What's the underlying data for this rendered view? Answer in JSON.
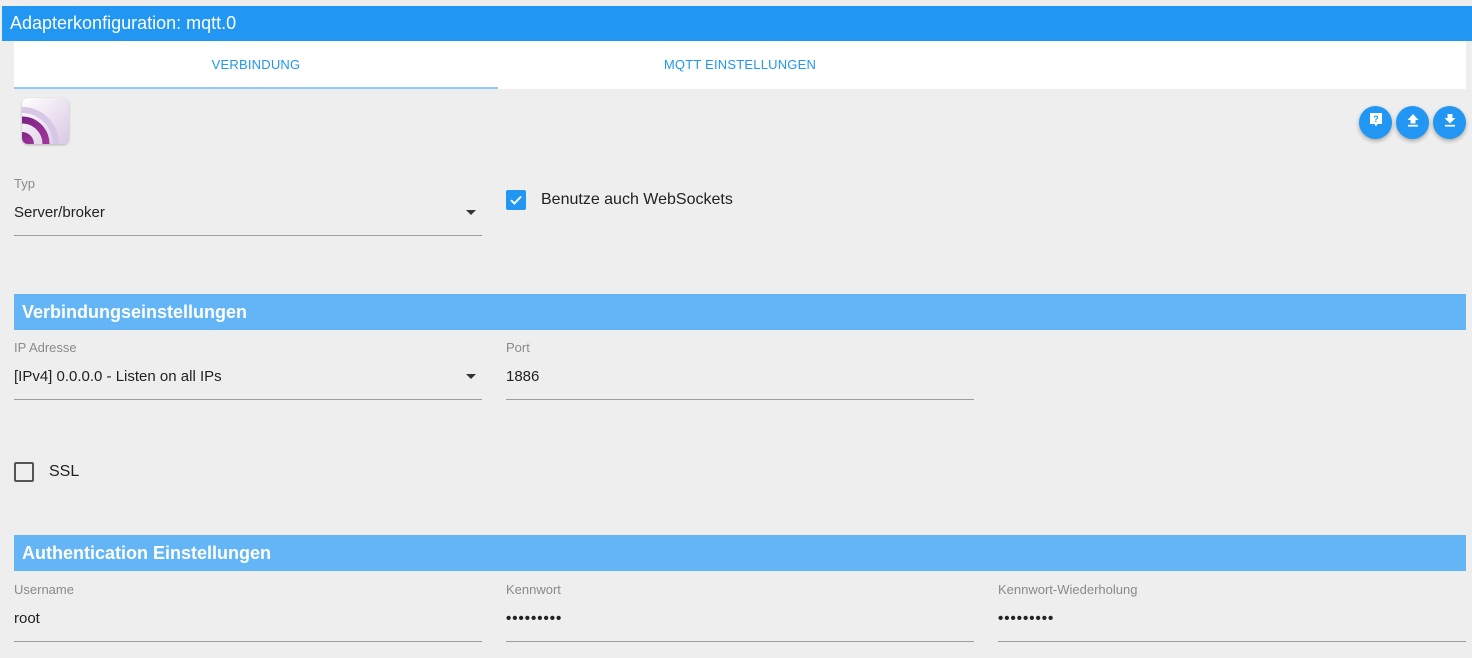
{
  "window": {
    "title": "Adapterkonfiguration: mqtt.0"
  },
  "tabs": [
    {
      "label": "VERBINDUNG",
      "active": true
    },
    {
      "label": "MQTT EINSTELLUNGEN",
      "active": false
    }
  ],
  "toolbar": {
    "icons": [
      "help-icon",
      "upload-icon",
      "download-icon"
    ]
  },
  "type_field": {
    "label": "Typ",
    "value": "Server/broker"
  },
  "websockets": {
    "label": "Benutze auch WebSockets",
    "checked": true
  },
  "connection_section": {
    "title": "Verbindungseinstellungen"
  },
  "ip_field": {
    "label": "IP Adresse",
    "value": "[IPv4] 0.0.0.0 - Listen on all IPs"
  },
  "port_field": {
    "label": "Port",
    "value": "1886"
  },
  "ssl": {
    "label": "SSL",
    "checked": false
  },
  "auth_section": {
    "title": "Authentication Einstellungen"
  },
  "username_field": {
    "label": "Username",
    "value": "root"
  },
  "password_field": {
    "label": "Kennwort",
    "value": "•••••••••"
  },
  "password_repeat_field": {
    "label": "Kennwort-Wiederholung",
    "value": "•••••••••"
  },
  "colors": {
    "primary": "#2196f3",
    "section": "#64b5f6",
    "background": "#eeeeee"
  }
}
